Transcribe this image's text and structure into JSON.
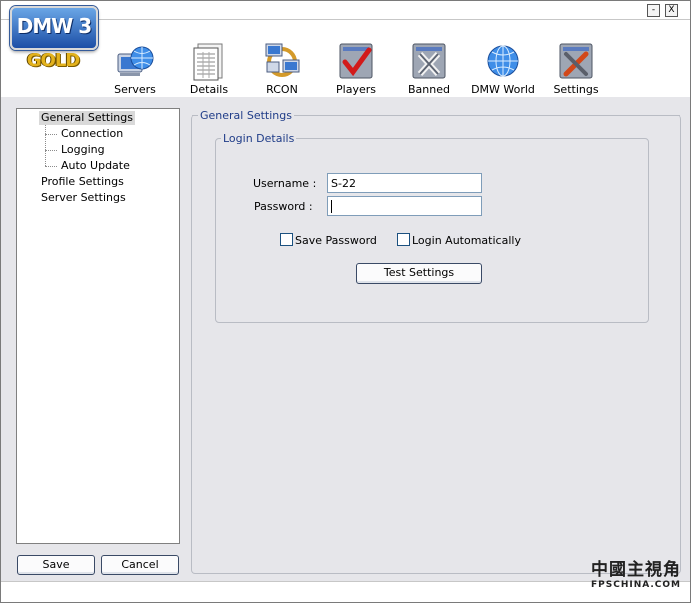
{
  "window": {
    "minimize_glyph": "-",
    "close_glyph": "X"
  },
  "logo": {
    "title": "DMW 3",
    "edition": "GOLD"
  },
  "toolbar": {
    "items": [
      {
        "label": "Servers",
        "icon": "servers-globe-icon"
      },
      {
        "label": "Details",
        "icon": "details-document-icon"
      },
      {
        "label": "RCON",
        "icon": "rcon-network-icon"
      },
      {
        "label": "Players",
        "icon": "players-checkmark-icon"
      },
      {
        "label": "Banned",
        "icon": "banned-x-icon"
      },
      {
        "label": "DMW World",
        "icon": "dmw-world-globe-icon"
      },
      {
        "label": "Settings",
        "icon": "settings-tools-icon"
      }
    ]
  },
  "tree": {
    "items": [
      {
        "label": "General Settings",
        "selected": true
      },
      {
        "label": "Connection"
      },
      {
        "label": "Logging"
      },
      {
        "label": "Auto Update"
      },
      {
        "label": "Profile Settings"
      },
      {
        "label": "Server Settings"
      }
    ]
  },
  "footer": {
    "save_label": "Save",
    "cancel_label": "Cancel"
  },
  "settings": {
    "section_title": "General Settings",
    "login_group_title": "Login Details",
    "username_label": "Username :",
    "username_value": "S-22",
    "password_label": "Password :",
    "password_value": "",
    "save_password_label": "Save Password",
    "save_password_checked": false,
    "login_auto_label": "Login Automatically",
    "login_auto_checked": false,
    "test_button_label": "Test Settings"
  },
  "watermark": {
    "line1": "中國主視角",
    "line2": "FPSCHINA.COM"
  },
  "colors": {
    "accent": "#1f3c88",
    "pane_bg": "#e6e6ea",
    "logo_blue": "#1c4ea6",
    "logo_gold": "#e3b21c"
  }
}
